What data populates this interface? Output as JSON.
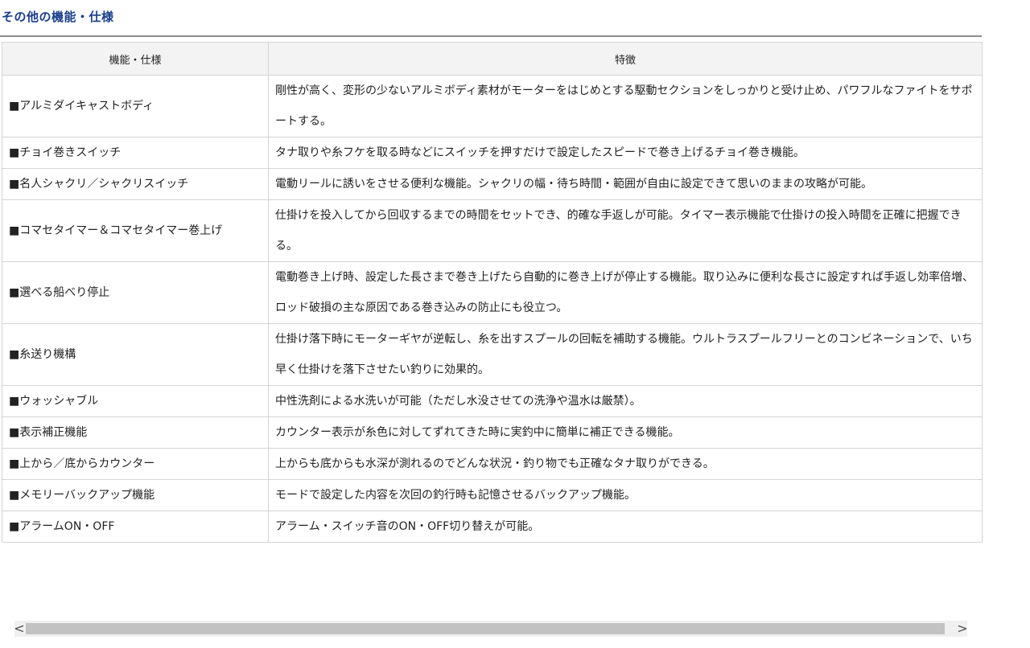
{
  "section_title": "その他の機能・仕様",
  "table": {
    "headers": [
      "機能・仕様",
      "特徴"
    ],
    "rows": [
      {
        "feature": "■アルミダイキャストボディ",
        "description": "剛性が高く、変形の少ないアルミボディ素材がモーターをはじめとする駆動セクションをしっかりと受け止め、パワフルなファイトをサポートする。"
      },
      {
        "feature": "■チョイ巻きスイッチ",
        "description": "タナ取りや糸フケを取る時などにスイッチを押すだけで設定したスピードで巻き上げるチョイ巻き機能。"
      },
      {
        "feature": "■名人シャクリ／シャクリスイッチ",
        "description": "電動リールに誘いをさせる便利な機能。シャクリの幅・待ち時間・範囲が自由に設定できて思いのままの攻略が可能。"
      },
      {
        "feature": "■コマセタイマー＆コマセタイマー巻上げ",
        "description": "仕掛けを投入してから回収するまでの時間をセットでき、的確な手返しが可能。タイマー表示機能で仕掛けの投入時間を正確に把握できる。"
      },
      {
        "feature": "■選べる船べり停止",
        "description": "電動巻き上げ時、設定した長さまで巻き上げたら自動的に巻き上げが停止する機能。取り込みに便利な長さに設定すれば手返し効率倍増、ロッド破損の主な原因である巻き込みの防止にも役立つ。"
      },
      {
        "feature": "■糸送り機構",
        "description": "仕掛け落下時にモーターギヤが逆転し、糸を出すスプールの回転を補助する機能。ウルトラスプールフリーとのコンビネーションで、いち早く仕掛けを落下させたい釣りに効果的。"
      },
      {
        "feature": "■ウォッシャブル",
        "description": "中性洗剤による水洗いが可能（ただし水没させての洗浄や温水は厳禁）。"
      },
      {
        "feature": "■表示補正機能",
        "description": "カウンター表示が糸色に対してずれてきた時に実釣中に簡単に補正できる機能。"
      },
      {
        "feature": "■上から／底からカウンター",
        "description": "上からも底からも水深が測れるのでどんな状況・釣り物でも正確なタナ取りができる。"
      },
      {
        "feature": "■メモリーバックアップ機能",
        "description": "モードで設定した内容を次回の釣行時も記憶させるバックアップ機能。"
      },
      {
        "feature": "■アラームON・OFF",
        "description": "アラーム・スイッチ音のON・OFF切り替えが可能。"
      }
    ]
  },
  "scrollbar": {
    "left_arrow": "<",
    "right_arrow": ">"
  }
}
